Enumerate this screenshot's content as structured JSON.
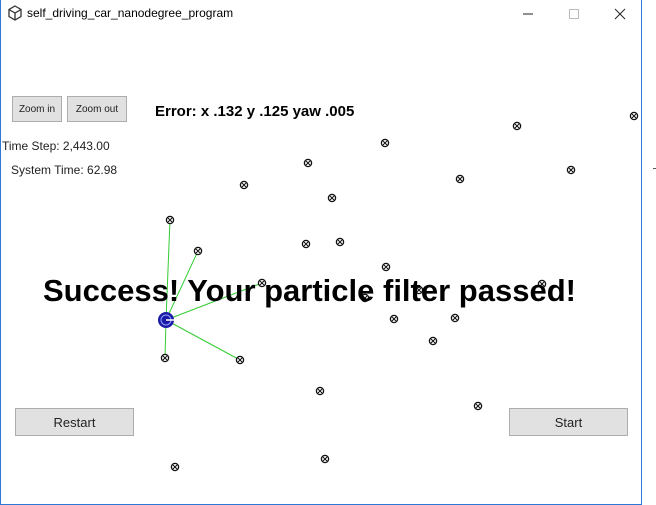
{
  "window": {
    "title": "self_driving_car_nanodegree_program"
  },
  "controls": {
    "zoom_in_label": "Zoom in",
    "zoom_out_label": "Zoom out",
    "restart_label": "Restart",
    "start_label": "Start"
  },
  "status": {
    "error": "Error: x .132 y .125 yaw .005",
    "time_step": "Time Step: 2,443.00",
    "system_time": "System Time: 62.98",
    "success_message": "Success! Your particle filter passed!"
  },
  "colors": {
    "vehicle": "#1a1aa6",
    "observation_line": "#33cc33",
    "landmark": "#111111",
    "button_face": "#e1e1e1"
  },
  "icons": {
    "app": "unity-logo-icon",
    "landmark": "landmark-marker-icon",
    "vehicle": "vehicle-icon"
  }
}
